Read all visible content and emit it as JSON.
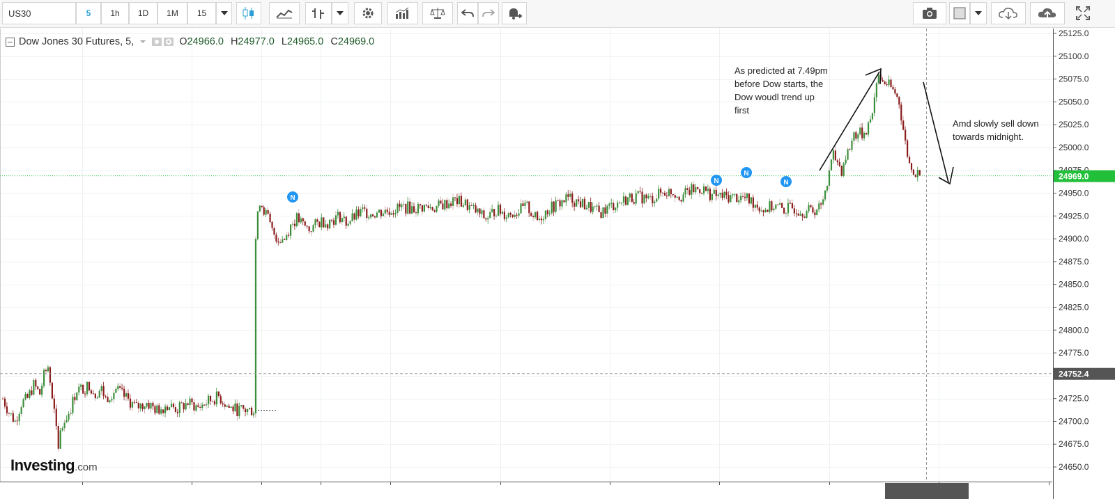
{
  "toolbar": {
    "symbol": "US30",
    "intervals": [
      "5",
      "1h",
      "1D",
      "1M",
      "15"
    ],
    "active_interval": "5"
  },
  "legend": {
    "title": "Dow Jones 30 Futures, 5,",
    "open": "24966.0",
    "high": "24977.0",
    "low": "24965.0",
    "close": "24969.0"
  },
  "annotations": {
    "up_note": [
      "As predicted at 7.49pm",
      "before Dow starts, the",
      "Dow woudl trend up",
      "first"
    ],
    "down_note": [
      "Amd slowly sell down",
      "towards midnight."
    ]
  },
  "brand": {
    "name": "Investing",
    "suffix": ".com"
  },
  "colors": {
    "up": "#3b8f3b",
    "down": "#8b1c1c",
    "last_price": "#22c03a",
    "news": "#2196f3"
  },
  "chart_data": {
    "type": "candlestick",
    "yaxis_ticks": [
      "25125.0",
      "25100.0",
      "25075.0",
      "25050.0",
      "25025.0",
      "25000.0",
      "24975.0",
      "24950.0",
      "24925.0",
      "24900.0",
      "24875.0",
      "24850.0",
      "24825.0",
      "24800.0",
      "24775.0",
      "24750.0",
      "24725.0",
      "24700.0",
      "24675.0",
      "24650.0"
    ],
    "ylim": [
      24640,
      25132
    ],
    "last_price": "24969.0",
    "marker_price": "24752.4",
    "news_marker_label": "N",
    "close_path": [
      [
        0,
        24725
      ],
      [
        3,
        24710
      ],
      [
        6,
        24700
      ],
      [
        9,
        24720
      ],
      [
        12,
        24725
      ],
      [
        15,
        24740
      ],
      [
        18,
        24730
      ],
      [
        20,
        24750
      ],
      [
        22,
        24760
      ],
      [
        24,
        24725
      ],
      [
        26,
        24695
      ],
      [
        27,
        24670
      ],
      [
        28,
        24690
      ],
      [
        30,
        24700
      ],
      [
        33,
        24715
      ],
      [
        36,
        24735
      ],
      [
        39,
        24735
      ],
      [
        42,
        24740
      ],
      [
        45,
        24730
      ],
      [
        48,
        24735
      ],
      [
        50,
        24725
      ],
      [
        55,
        24735
      ],
      [
        60,
        24725
      ],
      [
        65,
        24715
      ],
      [
        70,
        24720
      ],
      [
        75,
        24712
      ],
      [
        80,
        24718
      ],
      [
        85,
        24713
      ],
      [
        90,
        24720
      ],
      [
        95,
        24715
      ],
      [
        100,
        24722
      ],
      [
        105,
        24727
      ],
      [
        110,
        24715
      ],
      [
        115,
        24712
      ],
      [
        120,
        24712
      ],
      [
        122,
        24712
      ],
      [
        123,
        24900
      ],
      [
        124,
        24930
      ],
      [
        125,
        24942
      ],
      [
        127,
        24932
      ],
      [
        129,
        24922
      ],
      [
        131,
        24908
      ],
      [
        134,
        24900
      ],
      [
        137,
        24900
      ],
      [
        140,
        24915
      ],
      [
        143,
        24922
      ],
      [
        146,
        24915
      ],
      [
        149,
        24910
      ],
      [
        152,
        24915
      ],
      [
        155,
        24920
      ],
      [
        158,
        24918
      ],
      [
        161,
        24922
      ],
      [
        164,
        24925
      ],
      [
        167,
        24918
      ],
      [
        170,
        24922
      ],
      [
        175,
        24930
      ],
      [
        180,
        24928
      ],
      [
        185,
        24930
      ],
      [
        190,
        24932
      ],
      [
        195,
        24935
      ],
      [
        200,
        24933
      ],
      [
        205,
        24935
      ],
      [
        210,
        24934
      ],
      [
        215,
        24938
      ],
      [
        220,
        24942
      ],
      [
        225,
        24938
      ],
      [
        230,
        24930
      ],
      [
        235,
        24922
      ],
      [
        240,
        24932
      ],
      [
        245,
        24927
      ],
      [
        250,
        24930
      ],
      [
        255,
        24935
      ],
      [
        260,
        24920
      ],
      [
        265,
        24932
      ],
      [
        270,
        24938
      ],
      [
        275,
        24945
      ],
      [
        280,
        24940
      ],
      [
        285,
        24935
      ],
      [
        290,
        24928
      ],
      [
        295,
        24935
      ],
      [
        300,
        24940
      ],
      [
        305,
        24945
      ],
      [
        310,
        24946
      ],
      [
        315,
        24943
      ],
      [
        320,
        24950
      ],
      [
        325,
        24952
      ],
      [
        330,
        24947
      ],
      [
        335,
        24953
      ],
      [
        340,
        24955
      ],
      [
        345,
        24948
      ],
      [
        350,
        24946
      ],
      [
        355,
        24946
      ],
      [
        360,
        24945
      ],
      [
        365,
        24940
      ],
      [
        370,
        24932
      ],
      [
        375,
        24936
      ],
      [
        380,
        24932
      ],
      [
        385,
        24934
      ],
      [
        390,
        24930
      ],
      [
        395,
        24932
      ],
      [
        398,
        24935
      ],
      [
        400,
        24955
      ],
      [
        402,
        24975
      ],
      [
        404,
        24990
      ],
      [
        406,
        24985
      ],
      [
        408,
        24975
      ],
      [
        410,
        24990
      ],
      [
        412,
        25000
      ],
      [
        414,
        25015
      ],
      [
        416,
        25015
      ],
      [
        418,
        25015
      ],
      [
        420,
        25020
      ],
      [
        422,
        25030
      ],
      [
        424,
        25055
      ],
      [
        426,
        25078
      ],
      [
        428,
        25072
      ],
      [
        430,
        25070
      ],
      [
        432,
        25065
      ],
      [
        434,
        25060
      ],
      [
        436,
        25050
      ],
      [
        438,
        25020
      ],
      [
        440,
        24990
      ],
      [
        442,
        24975
      ],
      [
        444,
        24970
      ],
      [
        446,
        24969
      ]
    ]
  }
}
